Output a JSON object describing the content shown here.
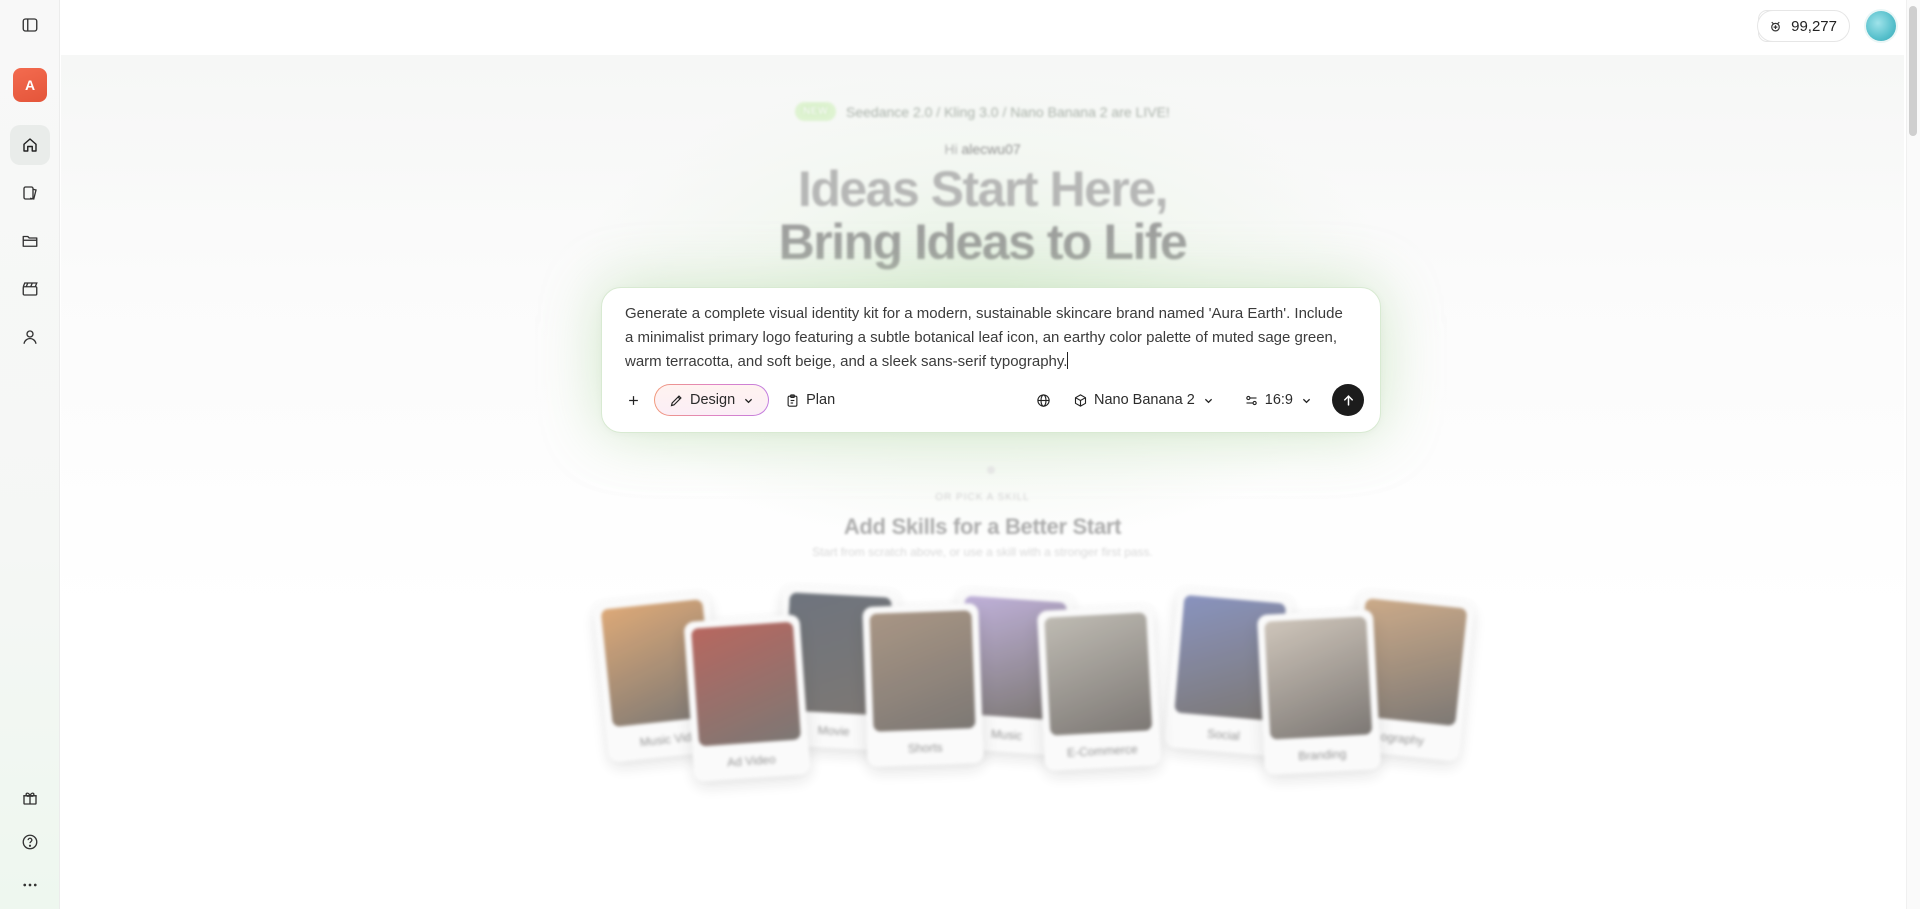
{
  "sidebar": {
    "logo_letter": "A",
    "nav_icons": [
      "sidebar-toggle-icon",
      "home-icon",
      "gallery-icon",
      "folder-icon",
      "clapperboard-icon",
      "user-icon"
    ],
    "bottom_icons": [
      "gift-icon",
      "help-icon",
      "more-icon"
    ]
  },
  "header": {
    "credits": "99,277"
  },
  "announcement": {
    "badge": "NEW",
    "text": "Seedance 2.0 / Kling 3.0 / Nano Banana 2 are LIVE!"
  },
  "greeting": {
    "hi": "Hi",
    "username": "alecwu07"
  },
  "hero": {
    "line1": "Ideas Start Here,",
    "line2": "Bring Ideas to Life"
  },
  "prompt": {
    "text": "Generate a complete visual identity kit for a modern, sustainable skincare brand named 'Aura Earth'. Include a minimalist primary logo featuring a subtle botanical leaf icon, an earthy color palette of muted sage green, warm terracotta, and soft beige, and a sleek sans-serif typography.",
    "mode": "Design",
    "plan": "Plan",
    "model": "Nano Banana 2",
    "ratio": "16:9"
  },
  "skills": {
    "overline": "OR PICK A SKILL",
    "title": "Add Skills for a Better Start",
    "subtitle": "Start from scratch above, or use a skill with a stronger first pass.",
    "cards": [
      {
        "label": "Music Vid",
        "color": "#d9a06a"
      },
      {
        "label": "Ad Video",
        "color": "#b0574f"
      },
      {
        "label": "Movie",
        "color": "#5f6670"
      },
      {
        "label": "Shorts",
        "color": "#a08b78"
      },
      {
        "label": "Music",
        "color": "#b9a9d6"
      },
      {
        "label": "E-Commerce",
        "color": "#b8b4ab"
      },
      {
        "label": "Social",
        "color": "#7d88b8"
      },
      {
        "label": "Branding",
        "color": "#c9bfb3"
      },
      {
        "label": "ography",
        "color": "#c7a27d"
      }
    ]
  }
}
